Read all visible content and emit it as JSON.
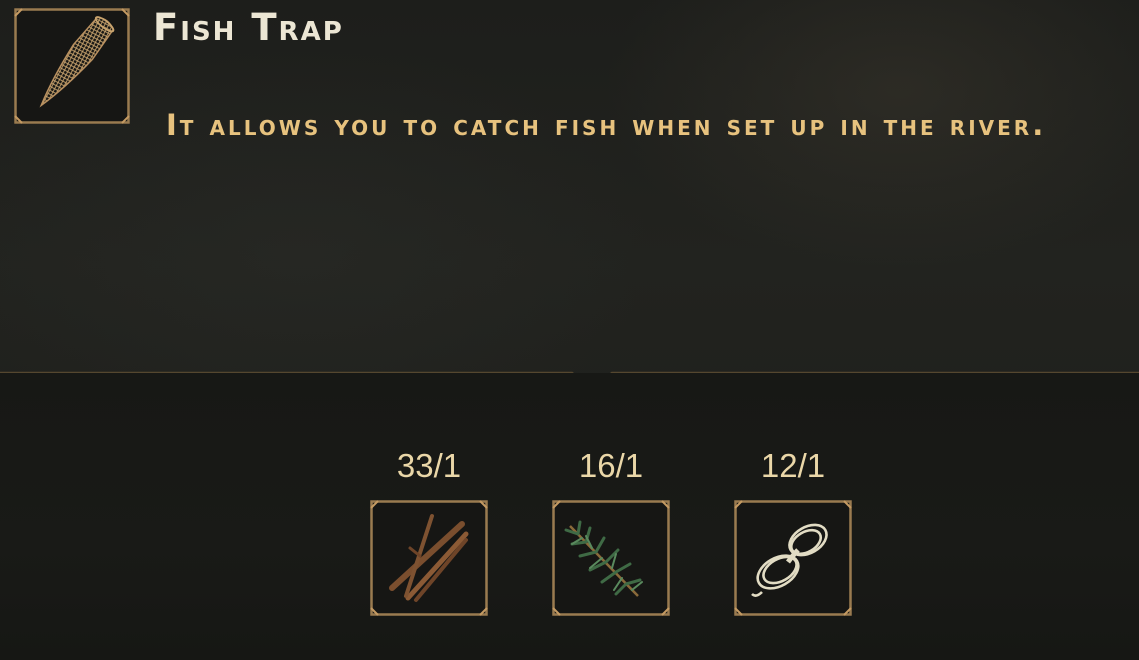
{
  "item": {
    "name": "Fish Trap",
    "description": "It allows you to catch fish when set up in the river.",
    "icon": "fish-trap-icon"
  },
  "requirements": [
    {
      "icon": "sticks-icon",
      "count": "33/1"
    },
    {
      "icon": "fir-branch-icon",
      "count": "16/1"
    },
    {
      "icon": "rope-icon",
      "count": "12/1"
    }
  ],
  "colors": {
    "title": "#ece6d4",
    "description": "#e7c27e",
    "frame": "#9a7b50",
    "count": "#ead7a8"
  }
}
